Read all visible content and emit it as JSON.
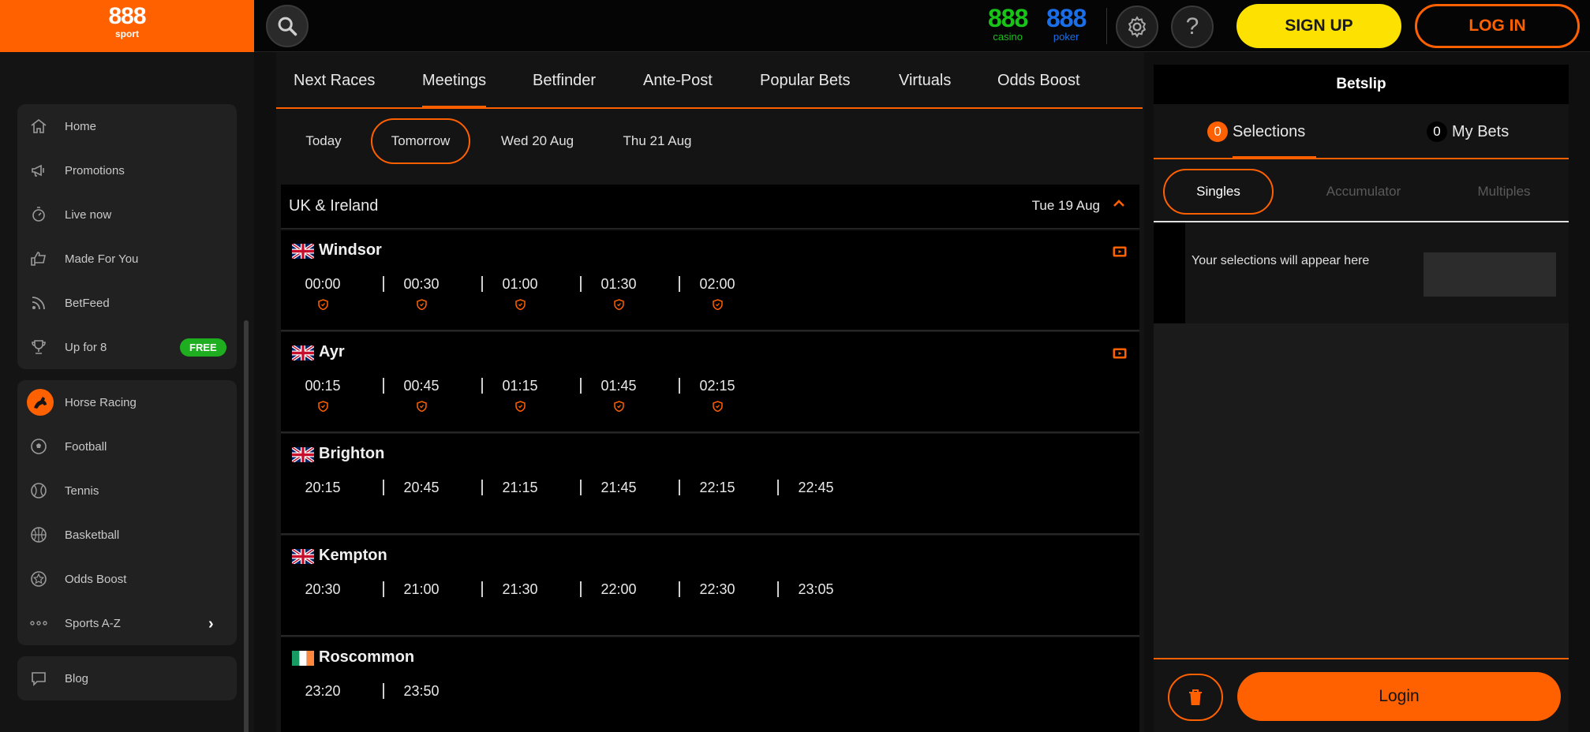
{
  "header": {
    "logo": {
      "main": "888",
      "sub": "sport"
    },
    "brands": [
      {
        "num": "888",
        "label": "casino",
        "color": "#18c418"
      },
      {
        "num": "888",
        "label": "poker",
        "color": "#1a6fe8"
      }
    ],
    "help_label": "?",
    "signup_label": "SIGN UP",
    "login_label": "LOG IN"
  },
  "sidebar": {
    "group1": [
      {
        "label": "Home",
        "icon": "home-icon"
      },
      {
        "label": "Promotions",
        "icon": "megaphone-icon"
      },
      {
        "label": "Live now",
        "icon": "stopwatch-icon"
      },
      {
        "label": "Made For You",
        "icon": "thumbs-up-icon"
      },
      {
        "label": "BetFeed",
        "icon": "feed-icon"
      },
      {
        "label": "Up for 8",
        "icon": "trophy-icon",
        "badge": "FREE"
      }
    ],
    "group2": [
      {
        "label": "Horse Racing",
        "icon": "horse-racing-icon"
      },
      {
        "label": "Football",
        "icon": "football-icon"
      },
      {
        "label": "Tennis",
        "icon": "tennis-icon"
      },
      {
        "label": "Basketball",
        "icon": "basketball-icon"
      },
      {
        "label": "Odds Boost",
        "icon": "odds-boost-icon"
      },
      {
        "label": "Sports A-Z",
        "icon": "dots-icon"
      }
    ],
    "group3": [
      {
        "label": "Blog",
        "icon": "blog-icon"
      }
    ]
  },
  "main": {
    "tabs": [
      "Next Races",
      "Meetings",
      "Betfinder",
      "Ante-Post",
      "Popular Bets",
      "Virtuals",
      "Odds Boost"
    ],
    "active_tab": "Meetings",
    "days": [
      "Today",
      "Tomorrow",
      "Wed 20 Aug",
      "Thu 21 Aug"
    ],
    "selected_day": "Tomorrow",
    "region": {
      "title": "UK & Ireland",
      "date": "Tue 19 Aug"
    },
    "meetings": [
      {
        "name": "Windsor",
        "flag": "uk",
        "tv": true,
        "shields": true,
        "times": [
          "00:00",
          "00:30",
          "01:00",
          "01:30",
          "02:00"
        ]
      },
      {
        "name": "Ayr",
        "flag": "uk",
        "tv": true,
        "shields": true,
        "times": [
          "00:15",
          "00:45",
          "01:15",
          "01:45",
          "02:15"
        ]
      },
      {
        "name": "Brighton",
        "flag": "uk",
        "tv": false,
        "shields": false,
        "times": [
          "20:15",
          "20:45",
          "21:15",
          "21:45",
          "22:15",
          "22:45"
        ]
      },
      {
        "name": "Kempton",
        "flag": "uk",
        "tv": false,
        "shields": false,
        "times": [
          "20:30",
          "21:00",
          "21:30",
          "22:00",
          "22:30",
          "23:05"
        ]
      },
      {
        "name": "Roscommon",
        "flag": "ie",
        "tv": false,
        "shields": false,
        "times": [
          "23:20",
          "23:50"
        ]
      }
    ]
  },
  "betslip": {
    "title": "Betslip",
    "tabs": [
      {
        "count": "0",
        "label": "Selections"
      },
      {
        "count": "0",
        "label": "My Bets"
      }
    ],
    "bet_types": [
      "Singles",
      "Accumulator",
      "Multiples"
    ],
    "selected_bet_type": "Singles",
    "empty_message": "Your selections will appear here",
    "login_label": "Login"
  },
  "colors": {
    "accent": "#ff6000",
    "signup": "#fde101",
    "free": "#1fae1f"
  }
}
